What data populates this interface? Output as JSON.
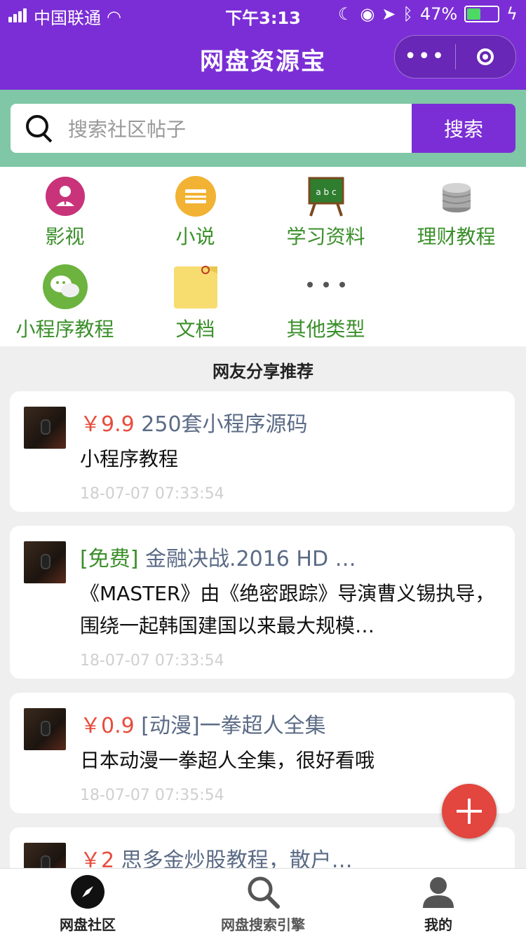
{
  "status_bar": {
    "carrier": "中国联通",
    "time": "下午3:13",
    "battery": "47%"
  },
  "header": {
    "title": "网盘资源宝"
  },
  "search": {
    "placeholder": "搜索社区帖子",
    "button": "搜索"
  },
  "categories": [
    {
      "label": "影视",
      "icon": "person-icon"
    },
    {
      "label": "小说",
      "icon": "card-icon"
    },
    {
      "label": "学习资料",
      "icon": "chalkboard-icon"
    },
    {
      "label": "理财教程",
      "icon": "coins-icon"
    },
    {
      "label": "小程序教程",
      "icon": "chat-icon"
    },
    {
      "label": "文档",
      "icon": "folder-icon"
    },
    {
      "label": "其他类型",
      "icon": "more-dots-icon"
    }
  ],
  "section_title": "网友分享推荐",
  "posts": [
    {
      "tag": "￥9.9",
      "tag_type": "price",
      "title": "250套小程序源码",
      "desc": "小程序教程",
      "time": "18-07-07 07:33:54"
    },
    {
      "tag": "[免费]",
      "tag_type": "free",
      "title": "金融决战.2016 HD …",
      "desc": "《MASTER》由《绝密跟踪》导演曹义锡执导，围绕一起韩国建国以来最大规模…",
      "time": "18-07-07 07:33:54"
    },
    {
      "tag": "￥0.9",
      "tag_type": "price",
      "title": "[动漫]一拳超人全集",
      "desc": "日本动漫一拳超人全集，很好看哦",
      "time": "18-07-07 07:35:54"
    },
    {
      "tag": "￥2",
      "tag_type": "price",
      "title": "思多金炒股教程，散户…",
      "desc": "",
      "time": ""
    }
  ],
  "tabbar": [
    {
      "label": "网盘社区",
      "icon": "compass-icon"
    },
    {
      "label": "网盘搜索引擎",
      "icon": "search-icon"
    },
    {
      "label": "我的",
      "icon": "user-icon"
    }
  ]
}
